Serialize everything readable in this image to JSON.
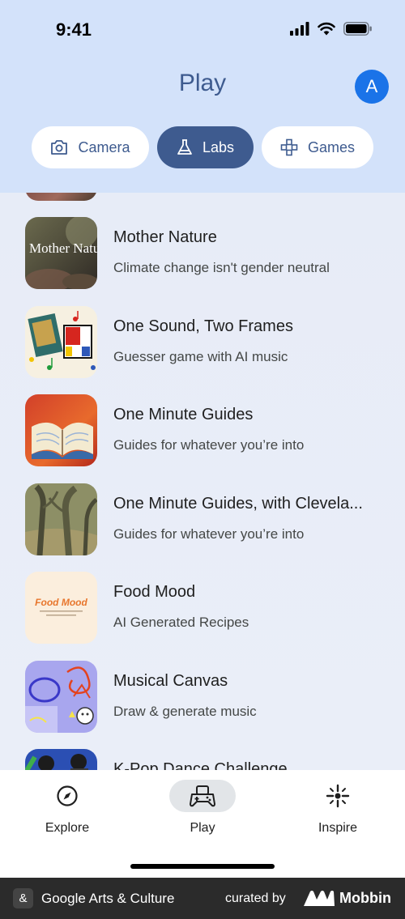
{
  "status_bar": {
    "time": "9:41"
  },
  "header": {
    "title": "Play",
    "avatar_initial": "A"
  },
  "chips": [
    {
      "label": "Camera",
      "icon": "camera-icon",
      "active": false
    },
    {
      "label": "Labs",
      "icon": "flask-icon",
      "active": true
    },
    {
      "label": "Games",
      "icon": "gamepad-icon",
      "active": false
    }
  ],
  "items": [
    {
      "title": "Mother Nature",
      "subtitle": "Climate change isn't gender neutral",
      "thumb_text": "Mother Nature"
    },
    {
      "title": "One Sound, Two Frames",
      "subtitle": "Guesser game with AI music"
    },
    {
      "title": "One Minute Guides",
      "subtitle": "Guides for whatever you’re into"
    },
    {
      "title": "One Minute Guides, with Clevela...",
      "subtitle": "Guides for whatever you’re into"
    },
    {
      "title": "Food Mood",
      "subtitle": "AI Generated Recipes",
      "thumb_text": "Food Mood"
    },
    {
      "title": "Musical Canvas",
      "subtitle": "Draw & generate music"
    },
    {
      "title": "K-Pop Dance Challenge",
      "subtitle": ""
    }
  ],
  "bottom_nav": [
    {
      "label": "Explore",
      "icon": "compass-icon",
      "active": false
    },
    {
      "label": "Play",
      "icon": "gamepad-icon",
      "active": true
    },
    {
      "label": "Inspire",
      "icon": "sparkle-icon",
      "active": false
    }
  ],
  "footer": {
    "app_name": "Google Arts & Culture",
    "logo_glyph": "&",
    "curated_by": "curated by",
    "brand": "Mobbin"
  },
  "colors": {
    "header_bg": "#d3e2fa",
    "accent": "#3e5b8f",
    "avatar": "#1a73e8",
    "footer_bg": "#2b2b2b"
  }
}
